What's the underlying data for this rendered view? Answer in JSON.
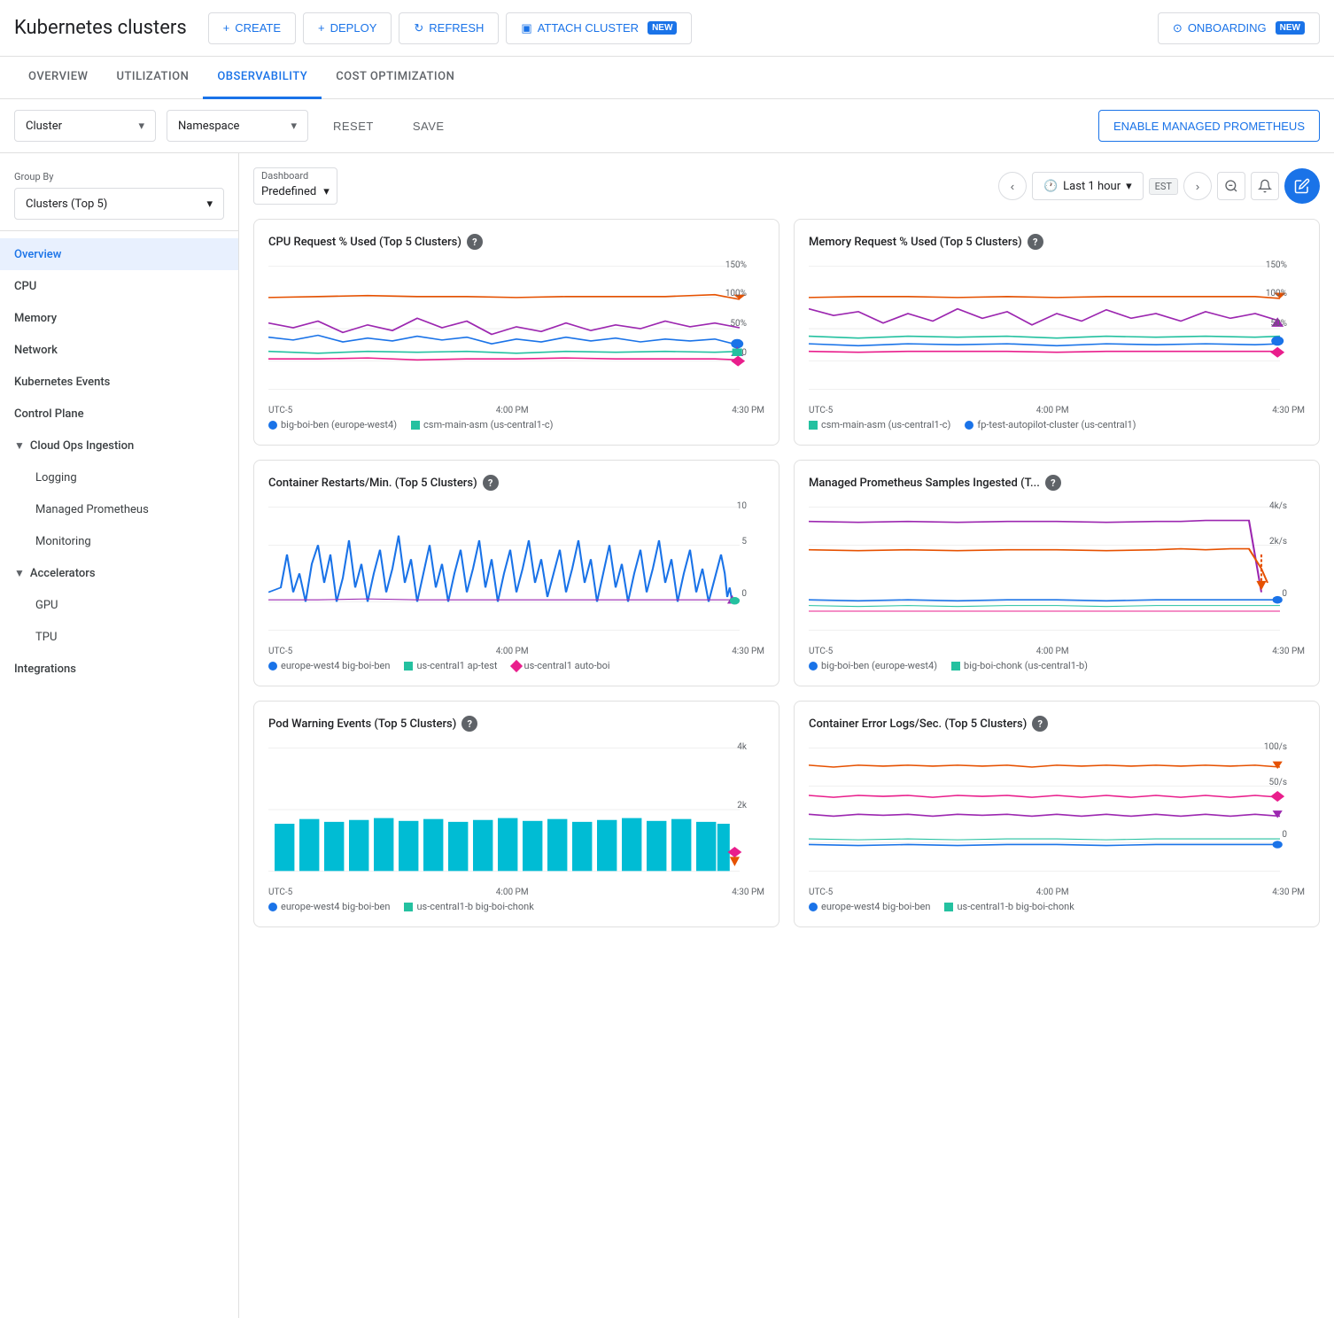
{
  "header": {
    "title": "Kubernetes clusters",
    "buttons": {
      "create": "CREATE",
      "deploy": "DEPLOY",
      "refresh": "REFRESH",
      "attach_cluster": "ATTACH CLUSTER",
      "attach_cluster_new": "NEW",
      "onboarding": "ONBOARDING",
      "onboarding_new": "NEW"
    }
  },
  "tabs": [
    {
      "label": "OVERVIEW",
      "active": false
    },
    {
      "label": "UTILIZATION",
      "active": false
    },
    {
      "label": "OBSERVABILITY",
      "active": true
    },
    {
      "label": "COST OPTIMIZATION",
      "active": false
    }
  ],
  "filters": {
    "cluster_label": "Cluster",
    "namespace_label": "Namespace",
    "reset_label": "RESET",
    "save_label": "SAVE",
    "enable_btn": "ENABLE MANAGED PROMETHEUS"
  },
  "sidebar": {
    "group_by_label": "Group By",
    "group_by_value": "Clusters (Top 5)",
    "items": [
      {
        "label": "Overview",
        "level": "top",
        "active": true
      },
      {
        "label": "CPU",
        "level": "top",
        "active": false
      },
      {
        "label": "Memory",
        "level": "top",
        "active": false
      },
      {
        "label": "Network",
        "level": "top",
        "active": false
      },
      {
        "label": "Kubernetes Events",
        "level": "top",
        "active": false
      },
      {
        "label": "Control Plane",
        "level": "top",
        "active": false
      },
      {
        "label": "Cloud Ops Ingestion",
        "level": "group",
        "active": false,
        "expanded": true
      },
      {
        "label": "Logging",
        "level": "sub",
        "active": false
      },
      {
        "label": "Managed Prometheus",
        "level": "sub",
        "active": false
      },
      {
        "label": "Monitoring",
        "level": "sub",
        "active": false
      },
      {
        "label": "Accelerators",
        "level": "group",
        "active": false,
        "expanded": true
      },
      {
        "label": "GPU",
        "level": "sub",
        "active": false
      },
      {
        "label": "TPU",
        "level": "sub",
        "active": false
      },
      {
        "label": "Integrations",
        "level": "top",
        "active": false
      }
    ]
  },
  "dashboard": {
    "label": "Dashboard",
    "value": "Predefined",
    "time_range": "Last 1 hour",
    "est_label": "EST"
  },
  "charts": [
    {
      "id": "cpu-request",
      "title": "CPU Request % Used (Top 5 Clusters)",
      "y_max": "150%",
      "y_mid": "100%",
      "y_low": "50%",
      "y_zero": "0",
      "x_labels": [
        "UTC-5",
        "4:00 PM",
        "4:30 PM"
      ],
      "legend": [
        {
          "shape": "dot",
          "color": "#1a73e8",
          "label": "big-boi-ben (europe-west4)"
        },
        {
          "shape": "sq",
          "color": "#24c1a0",
          "label": "csm-main-asm (us-central1-c)"
        }
      ]
    },
    {
      "id": "memory-request",
      "title": "Memory Request % Used (Top 5 Clusters)",
      "y_max": "150%",
      "y_mid": "100%",
      "y_low": "50%",
      "x_labels": [
        "UTC-5",
        "4:00 PM",
        "4:30 PM"
      ],
      "legend": [
        {
          "shape": "sq",
          "color": "#24c1a0",
          "label": "csm-main-asm (us-central1-c)"
        },
        {
          "shape": "dot",
          "color": "#1a73e8",
          "label": "fp-test-autopilot-cluster (us-central1)"
        }
      ]
    },
    {
      "id": "container-restarts",
      "title": "Container Restarts/Min. (Top 5 Clusters)",
      "y_max": "10",
      "y_mid": "5",
      "y_zero": "0",
      "x_labels": [
        "UTC-5",
        "4:00 PM",
        "4:30 PM"
      ],
      "legend": [
        {
          "shape": "dot",
          "color": "#1a73e8",
          "label": "europe-west4 big-boi-ben"
        },
        {
          "shape": "sq",
          "color": "#24c1a0",
          "label": "us-central1 ap-test"
        },
        {
          "shape": "diamond",
          "color": "#e91e8c",
          "label": "us-central1 auto-boi"
        }
      ]
    },
    {
      "id": "managed-prometheus",
      "title": "Managed Prometheus Samples Ingested (T...",
      "y_max": "4k/s",
      "y_mid": "2k/s",
      "y_zero": "0",
      "x_labels": [
        "UTC-5",
        "4:00 PM",
        "4:30 PM"
      ],
      "legend": [
        {
          "shape": "dot",
          "color": "#1a73e8",
          "label": "big-boi-ben (europe-west4)"
        },
        {
          "shape": "sq",
          "color": "#24c1a0",
          "label": "big-boi-chonk (us-central1-b)"
        }
      ]
    },
    {
      "id": "pod-warning",
      "title": "Pod Warning Events (Top 5 Clusters)",
      "y_max": "4k",
      "y_mid": "2k",
      "x_labels": [
        "UTC-5",
        "4:00 PM",
        "4:30 PM"
      ],
      "legend": [
        {
          "shape": "dot",
          "color": "#1a73e8",
          "label": "europe-west4 big-boi-ben"
        },
        {
          "shape": "sq",
          "color": "#24c1a0",
          "label": "us-central1-b big-boi-chonk"
        }
      ]
    },
    {
      "id": "container-error",
      "title": "Container Error Logs/Sec. (Top 5 Clusters)",
      "y_max": "100/s",
      "y_mid": "50/s",
      "y_zero": "0",
      "x_labels": [
        "UTC-5",
        "4:00 PM",
        "4:30 PM"
      ],
      "legend": [
        {
          "shape": "dot",
          "color": "#1a73e8",
          "label": "europe-west4 big-boi-ben"
        },
        {
          "shape": "sq",
          "color": "#24c1a0",
          "label": "us-central1-b big-boi-chonk"
        }
      ]
    }
  ]
}
